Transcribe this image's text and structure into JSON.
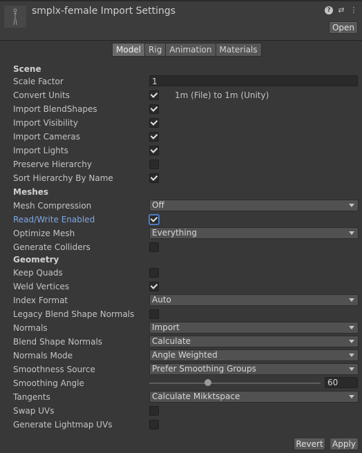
{
  "header": {
    "title": "smplx-female Import Settings",
    "open_label": "Open",
    "icons": [
      "help-icon",
      "preset-sliders-icon",
      "more-menu-icon"
    ]
  },
  "tabs": [
    "Model",
    "Rig",
    "Animation",
    "Materials"
  ],
  "active_tab": "Model",
  "sections": {
    "scene": "Scene",
    "meshes": "Meshes",
    "geometry": "Geometry"
  },
  "fields": {
    "scale_factor": {
      "label": "Scale Factor",
      "value": "1"
    },
    "convert_units": {
      "label": "Convert Units",
      "checked": true,
      "note": "1m (File) to 1m (Unity)"
    },
    "import_blendshapes": {
      "label": "Import BlendShapes",
      "checked": true
    },
    "import_visibility": {
      "label": "Import Visibility",
      "checked": true
    },
    "import_cameras": {
      "label": "Import Cameras",
      "checked": true
    },
    "import_lights": {
      "label": "Import Lights",
      "checked": true
    },
    "preserve_hierarchy": {
      "label": "Preserve Hierarchy",
      "checked": false
    },
    "sort_hierarchy": {
      "label": "Sort Hierarchy By Name",
      "checked": true
    },
    "mesh_compression": {
      "label": "Mesh Compression",
      "value": "Off"
    },
    "read_write": {
      "label": "Read/Write Enabled",
      "checked": true
    },
    "optimize_mesh": {
      "label": "Optimize Mesh",
      "value": "Everything"
    },
    "generate_colliders": {
      "label": "Generate Colliders",
      "checked": false
    },
    "keep_quads": {
      "label": "Keep Quads",
      "checked": false
    },
    "weld_vertices": {
      "label": "Weld Vertices",
      "checked": true
    },
    "index_format": {
      "label": "Index Format",
      "value": "Auto"
    },
    "legacy_blend": {
      "label": "Legacy Blend Shape Normals",
      "checked": false
    },
    "normals": {
      "label": "Normals",
      "value": "Import"
    },
    "blend_shape_normals": {
      "label": "Blend Shape Normals",
      "value": "Calculate"
    },
    "normals_mode": {
      "label": "Normals Mode",
      "value": "Angle Weighted"
    },
    "smoothness_source": {
      "label": "Smoothness Source",
      "value": "Prefer Smoothing Groups"
    },
    "smoothing_angle": {
      "label": "Smoothing Angle",
      "value": "60"
    },
    "tangents": {
      "label": "Tangents",
      "value": "Calculate Mikktspace"
    },
    "swap_uvs": {
      "label": "Swap UVs",
      "checked": false
    },
    "lightmap_uvs": {
      "label": "Generate Lightmap UVs",
      "checked": false
    }
  },
  "footer": {
    "revert_label": "Revert",
    "apply_label": "Apply"
  },
  "colors": {
    "background": "#383838",
    "highlight_label": "#7ea7e6",
    "focus_outline": "#4a7ec8"
  }
}
